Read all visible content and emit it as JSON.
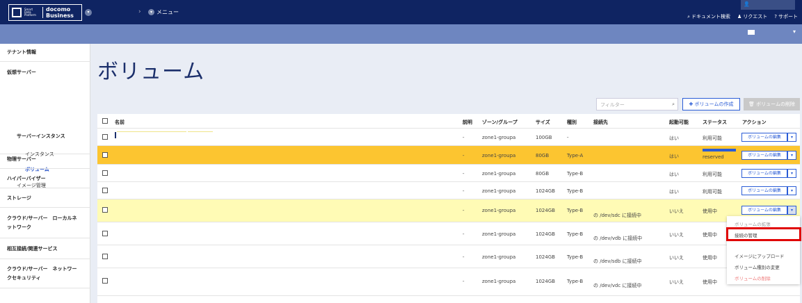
{
  "brand": {
    "logo_small": "Smart Data Platform",
    "logo_top": "docomo",
    "logo_bottom": "Business"
  },
  "header": {
    "menu_label": "メニュー",
    "links": [
      {
        "icon": "search-icon",
        "label": "ドキュメント検索"
      },
      {
        "icon": "person-icon",
        "label": "リクエスト"
      },
      {
        "icon": "help-icon",
        "label": "サポート"
      }
    ]
  },
  "sidebar": {
    "tenant": "テナント情報",
    "virtual_server": "仮想サーバー",
    "server_instance": "サーバーインスタンス",
    "instance": "インスタンス",
    "volume": "ボリューム",
    "image": "イメージ管理",
    "physical_server": "物理サーバー",
    "hypervisor": "ハイパーバイザー",
    "storage": "ストレージ",
    "cloud_local_network": "クラウド/サーバー　ローカルネットワーク",
    "interconnect": "相互接続/関連サービス",
    "cloud_network_security": "クラウド/サーバー　ネットワークセキュリティ"
  },
  "page": {
    "title": "ボリューム",
    "filter_placeholder": "フィルター",
    "create_button": "ボリュームの作成",
    "delete_button": "ボリュームの削除"
  },
  "table": {
    "headers": {
      "name": "名前",
      "description": "説明",
      "zone": "ゾーン/グループ",
      "size": "サイズ",
      "type": "種別",
      "attached": "接続先",
      "bootable": "起動可能",
      "status": "ステータス",
      "action": "アクション"
    },
    "rows": [
      {
        "desc": "-",
        "zone": "zone1-groupa",
        "size": "100GB",
        "type": "-",
        "attached": "",
        "bootable": "はい",
        "status": "利用可能",
        "action": "ボリュームの編集"
      },
      {
        "desc": "-",
        "zone": "zone1-groupa",
        "size": "80GB",
        "type": "Type-A",
        "attached": "",
        "bootable": "はい",
        "status": "reserved",
        "action": "ボリュームの編集"
      },
      {
        "desc": "-",
        "zone": "zone1-groupa",
        "size": "80GB",
        "type": "Type-B",
        "attached": "",
        "bootable": "はい",
        "status": "利用可能",
        "action": "ボリュームの編集"
      },
      {
        "desc": "-",
        "zone": "zone1-groupa",
        "size": "1024GB",
        "type": "Type-B",
        "attached": "",
        "bootable": "はい",
        "status": "利用可能",
        "action": "ボリュームの編集"
      },
      {
        "desc": "-",
        "zone": "zone1-groupa",
        "size": "1024GB",
        "type": "Type-B",
        "attached": "の /dev/sdc に接続中",
        "bootable": "いいえ",
        "status": "使用中",
        "action": "ボリュームの編集"
      },
      {
        "desc": "-",
        "zone": "zone1-groupa",
        "size": "1024GB",
        "type": "Type-B",
        "attached": "の /dev/vdb に接続中",
        "bootable": "いいえ",
        "status": "使用中",
        "action": ""
      },
      {
        "desc": "-",
        "zone": "zone1-groupa",
        "size": "1024GB",
        "type": "Type-B",
        "attached": "の /dev/sdb に接続中",
        "bootable": "いいえ",
        "status": "使用中",
        "action": ""
      },
      {
        "desc": "-",
        "zone": "zone1-groupa",
        "size": "1024GB",
        "type": "Type-B",
        "attached": "の /dev/vdc に接続中",
        "bootable": "いいえ",
        "status": "使用中",
        "action": ""
      }
    ]
  },
  "dropdown": {
    "items": [
      "ボリュームの拡張",
      "接続の管理",
      "",
      "イメージにアップロード",
      "ボリューム種別の変更",
      "ボリュームの削除"
    ]
  },
  "colors": {
    "topbar": "#0f2462",
    "subbar": "#6e86c0",
    "selected_row": "#fcc530",
    "highlight_row": "#fffbb5",
    "accent": "#2a5cd6",
    "highlight_box": "#e00000"
  }
}
